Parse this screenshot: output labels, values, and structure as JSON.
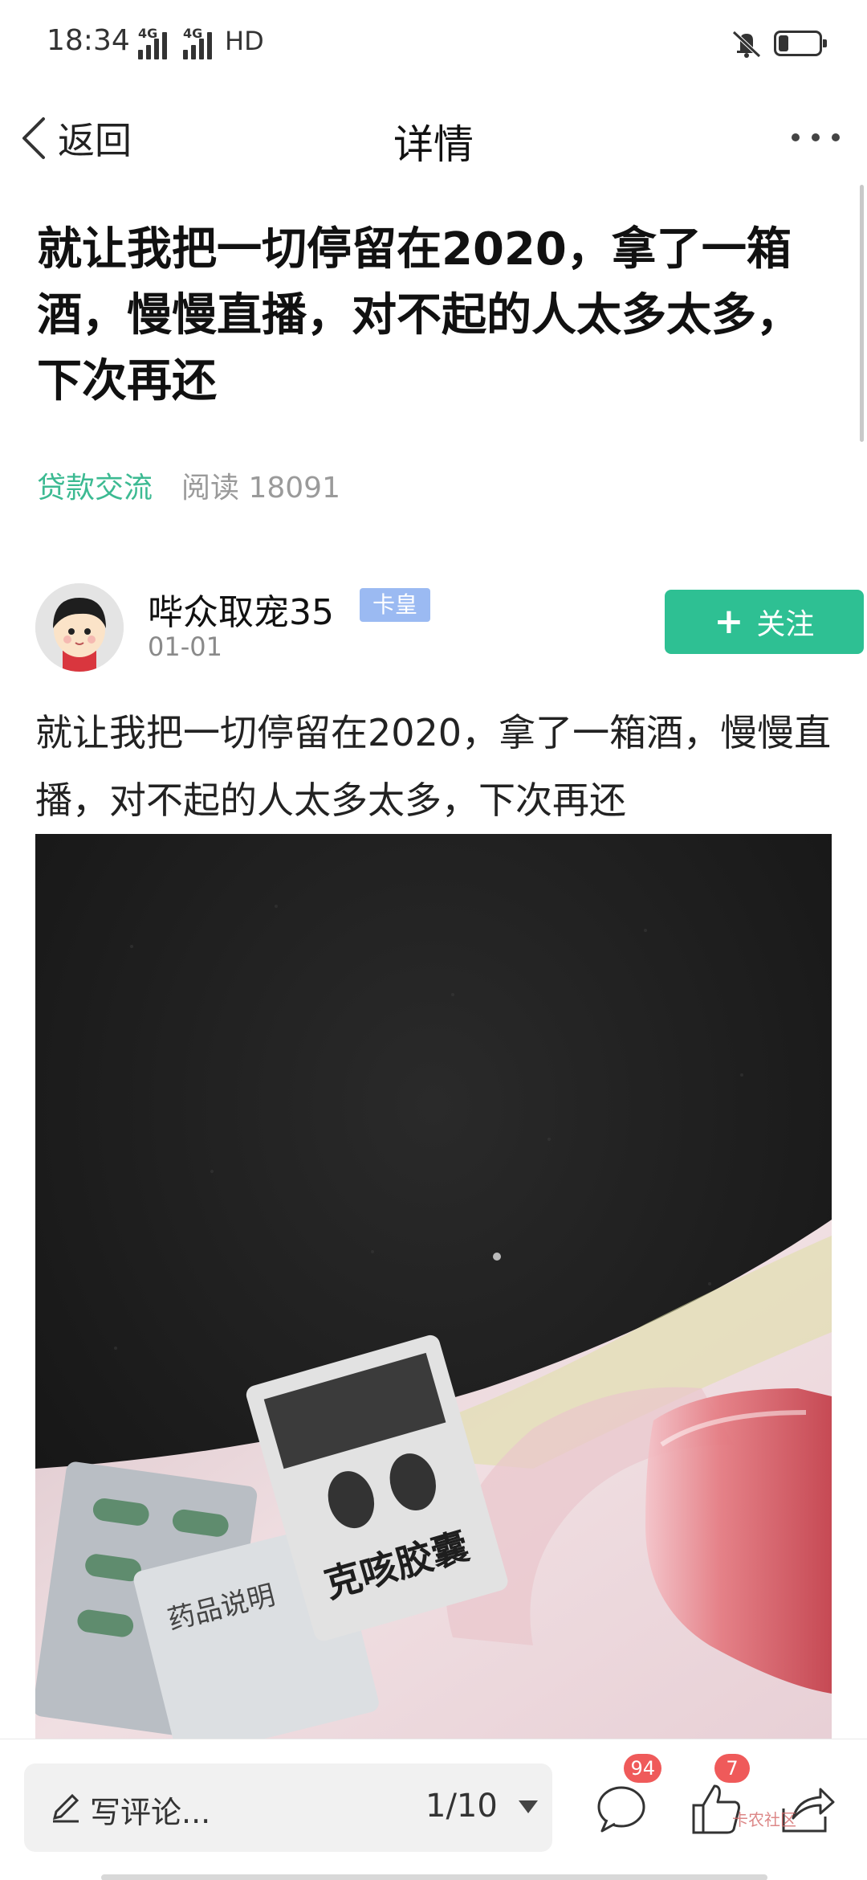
{
  "status_bar": {
    "time": "18:34",
    "network_1": "4G",
    "network_2": "4G",
    "hd_label": "HD",
    "mute_icon": "bell-off-icon",
    "battery_icon": "battery-icon"
  },
  "nav": {
    "back_label": "返回",
    "title": "详情",
    "more_icon": "more-dots-icon"
  },
  "post": {
    "title": "就让我把一切停留在2020，拿了一箱酒，慢慢直播，对不起的人太多太多，下次再还",
    "category": "贷款交流",
    "read_count": "阅读 18091",
    "body": "就让我把一切停留在2020，拿了一箱酒，慢慢直播，对不起的人太多太多，下次再还"
  },
  "author": {
    "name": "哔众取宠35",
    "badge": "卡皇",
    "date": "01-01",
    "follow_label": "关注"
  },
  "image_labels": {
    "pack_front": "克咳胶囊"
  },
  "bottom_bar": {
    "comment_placeholder": "写评论...",
    "page_indicator": "1/10",
    "comment_count": "94",
    "like_count": "7",
    "watermark": "卡农社区"
  },
  "colors": {
    "accent_green": "#2ec093",
    "category_green": "#3cba92",
    "badge_blue": "#9bbaf2",
    "count_red": "#ef5a5a"
  }
}
